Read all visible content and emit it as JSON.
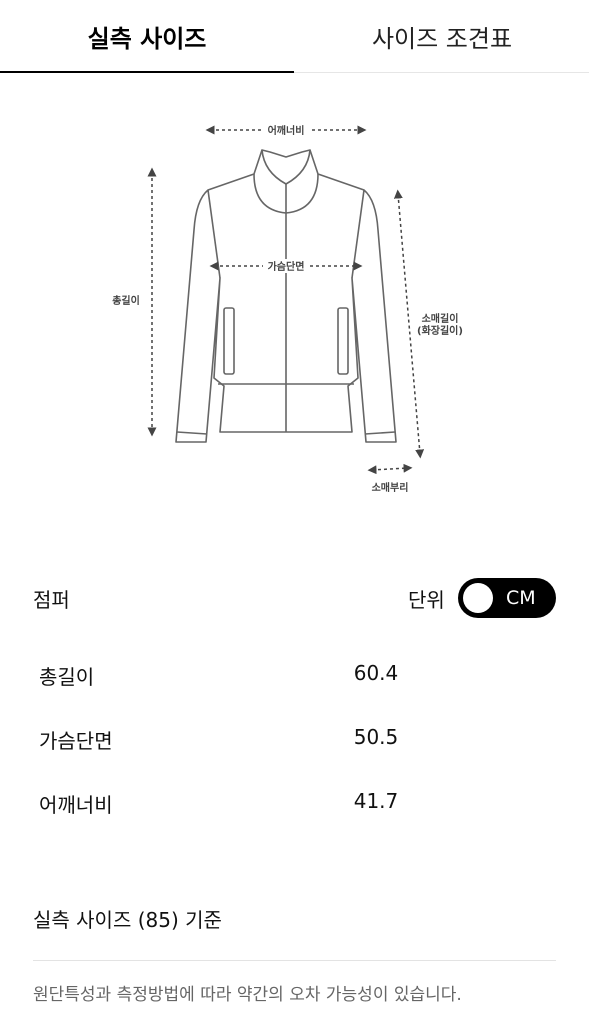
{
  "tabs": [
    {
      "label": "실측 사이즈",
      "active": true
    },
    {
      "label": "사이즈 조견표",
      "active": false
    }
  ],
  "diagram": {
    "shoulder_label": "어깨너비",
    "chest_label": "가슴단면",
    "length_label": "총길이",
    "sleeve_label": "소매길이",
    "sleeve_label_sub": "(화장길이)",
    "cuff_label": "소매부리"
  },
  "product": {
    "name": "점퍼"
  },
  "unit": {
    "label": "단위",
    "value": "CM"
  },
  "measurements": [
    {
      "label": "총길이",
      "value": "60.4"
    },
    {
      "label": "가슴단면",
      "value": "50.5"
    },
    {
      "label": "어깨너비",
      "value": "41.7"
    }
  ],
  "basis": "실측 사이즈 (85) 기준",
  "disclaimer": "원단특성과 측정방법에 따라 약간의 오차 가능성이 있습니다."
}
